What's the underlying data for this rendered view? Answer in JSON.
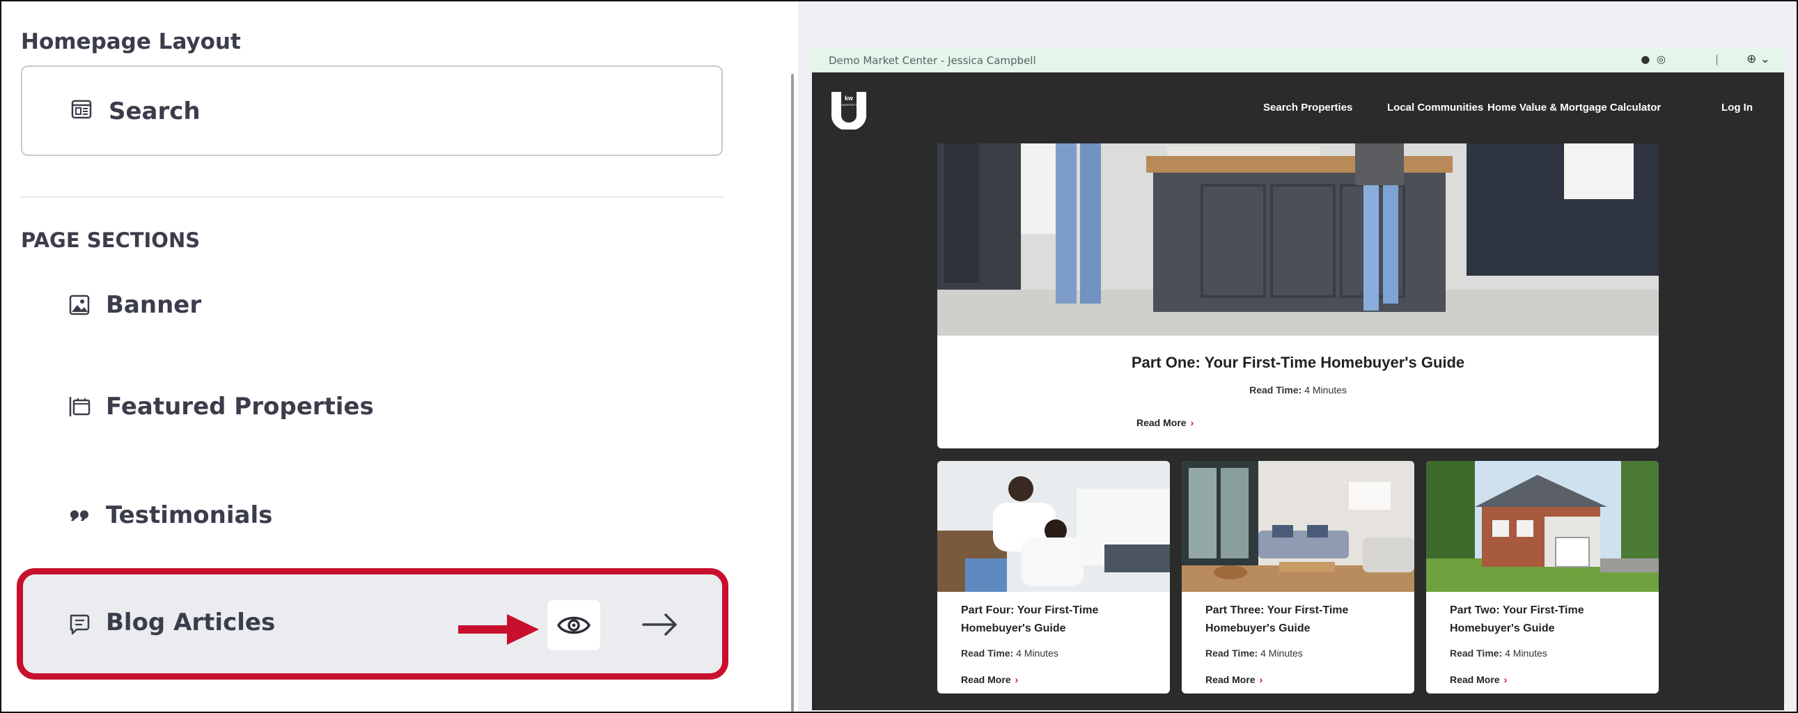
{
  "left_panel": {
    "title": "Homepage Layout",
    "search_card": {
      "label": "Search",
      "icon": "search-layout-icon"
    },
    "section_heading": "PAGE SECTIONS",
    "sections": [
      {
        "label": "Banner",
        "icon": "image-icon"
      },
      {
        "label": "Featured Properties",
        "icon": "featured-properties-icon"
      },
      {
        "label": "Testimonials",
        "icon": "quote-icon"
      },
      {
        "label": "Blog Articles",
        "icon": "chat-bubble-icon",
        "highlighted": true
      }
    ],
    "colors": {
      "highlight": "#c8102e",
      "row_bg": "#ebecef",
      "text": "#3b3d4b"
    }
  },
  "preview": {
    "topbar": {
      "agent": "Demo Market Center - Jessica Campbell",
      "separator": "|"
    },
    "logo_text": "kw UNIVERSITY",
    "nav": [
      "Search Properties",
      "Local Communities",
      "Home Value & Mortgage Calculator",
      "Log In"
    ],
    "featured_article": {
      "title": "Part One: Your First-Time Homebuyer's Guide",
      "read_label": "Read Time:",
      "read_value": "4 Minutes",
      "more": "Read More"
    },
    "articles": [
      {
        "title": "Part Four: Your First-Time Homebuyer's Guide",
        "read_label": "Read Time:",
        "read_value": "4 Minutes",
        "more": "Read More"
      },
      {
        "title": "Part Three: Your First-Time Homebuyer's Guide",
        "read_label": "Read Time:",
        "read_value": "4 Minutes",
        "more": "Read More"
      },
      {
        "title": "Part Two: Your First-Time Homebuyer's Guide",
        "read_label": "Read Time:",
        "read_value": "4 Minutes",
        "more": "Read More"
      }
    ],
    "colors": {
      "site_bg": "#2b2b2b",
      "topbar_bg": "#e4f6ea",
      "accent": "#c8102e"
    }
  }
}
